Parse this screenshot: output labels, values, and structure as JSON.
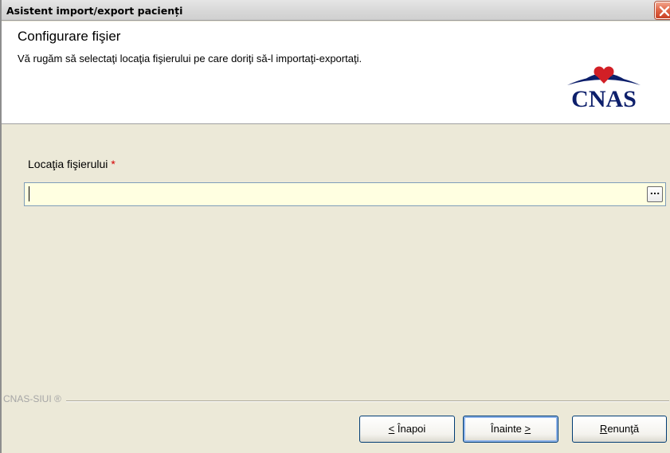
{
  "window": {
    "title": "Asistent import/export pacienți"
  },
  "header": {
    "title": "Configurare fişier",
    "description": "Vă rugăm să selectaţi locaţia fişierului pe care doriţi să-l importaţi-exportaţi.",
    "logo_text": "CNAS"
  },
  "form": {
    "file_location_label": "Locaţia fişierului",
    "required_marker": "*",
    "file_location_value": "",
    "browse_label": "..."
  },
  "footer": {
    "brand": "CNAS-SIUI ®"
  },
  "buttons": {
    "back_mnemonic": "<",
    "back_text": " Înapoi",
    "next_text": "Înainte ",
    "next_mnemonic": ">",
    "cancel_mnemonic": "R",
    "cancel_text": "enunţă"
  },
  "colors": {
    "input_background": "#ffffe1",
    "required": "#d40000",
    "logo_navy": "#0d1f6b",
    "logo_red": "#d21f26"
  }
}
